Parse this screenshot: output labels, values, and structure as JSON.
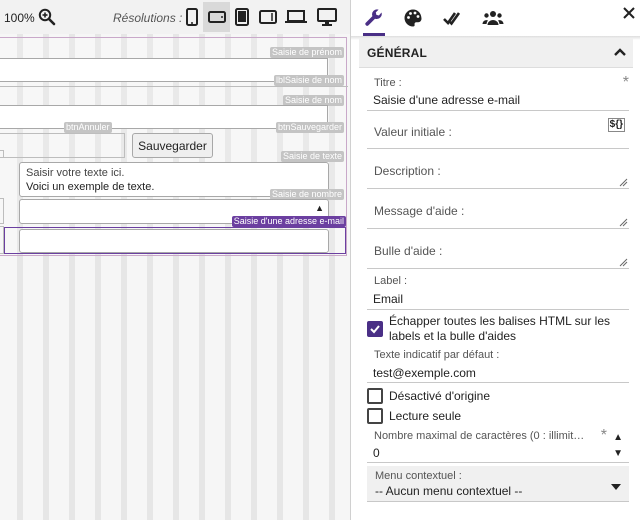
{
  "toolbar": {
    "zoom_label": "100%",
    "zoom_icon": "zoom-in-icon",
    "resolutions_label": "Résolutions :",
    "resolution_buttons": [
      "phone-portrait-icon",
      "phone-landscape-icon",
      "tablet-portrait-icon",
      "tablet-landscape-icon",
      "laptop-icon",
      "desktop-icon"
    ],
    "active_resolution": "phone-landscape-icon"
  },
  "canvas": {
    "tags": {
      "prenom": "Saisie de prénom",
      "lbl_nom": "lblSaisie de nom",
      "nom": "Saisie de nom",
      "btn_annuler": "btnAnnuler",
      "btn_sauvegarder": "btnSauvegarder",
      "texte": "Saisie de texte",
      "nombre": "Saisie de nombre",
      "email": "Saisie d'une adresse e-mail"
    },
    "save_button_label": "Sauvegarder",
    "textarea_placeholder": "Saisir votre texte ici.",
    "textarea_value": "Voici un exemple de texte.",
    "number_arrow": "▲"
  },
  "panel": {
    "tabs": [
      "wrench-icon",
      "palette-icon",
      "double-check-icon",
      "users-icon"
    ],
    "active_tab": "wrench-icon",
    "close_icon": "close-icon",
    "section_title": "GÉNÉRAL",
    "section_chevron": "chevron-up-icon",
    "title_label": "Titre :",
    "title_value": "Saisie d'une adresse e-mail",
    "required_mark": "*",
    "initial_value_label": "Valeur initiale :",
    "var_button": "${}",
    "description_label": "Description :",
    "help_message_label": "Message d'aide :",
    "help_bubble_label": "Bulle d'aide :",
    "label_label": "Label :",
    "label_value": "Email",
    "escape_html_label": "Échapper toutes les balises HTML sur les labels et la bulle d'aides",
    "escape_html_checked": true,
    "placeholder_label": "Texte indicatif par défaut :",
    "placeholder_value": "test@exemple.com",
    "disabled_label": "Désactivé d'origine",
    "disabled_checked": false,
    "readonly_label": "Lecture seule",
    "readonly_checked": false,
    "maxlength_label": "Nombre maximal de caractères (0 : illimit…",
    "maxlength_value": "0",
    "context_menu_label": "Menu contextuel :",
    "context_menu_value": "-- Aucun menu contextuel --"
  },
  "colors": {
    "accent": "#4a2f86",
    "selection": "#6b3fa0",
    "tag_gray": "#c4c4c4"
  }
}
